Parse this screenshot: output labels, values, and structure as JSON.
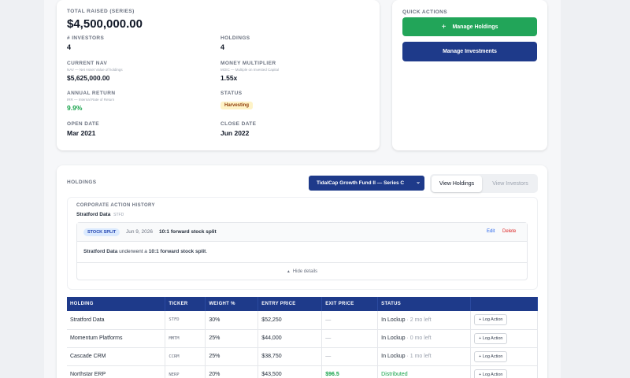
{
  "summary": {
    "total_raised_label": "TOTAL RAISED (SERIES)",
    "total_raised_value": "$4,500,000.00",
    "investors_label": "# INVESTORS",
    "investors_value": "4",
    "holdings_label": "HOLDINGS",
    "holdings_value": "4",
    "nav_label": "CURRENT NAV",
    "nav_sub": "NAV — Net Asset Value of holdings",
    "nav_value": "$5,625,000.00",
    "moic_label": "MONEY MULTIPLIER",
    "moic_sub": "MOIC — Multiple on Invested Capital",
    "moic_value": "1.55x",
    "return_label": "ANNUAL RETURN",
    "return_sub": "IRR — Internal Rate of Return",
    "return_value": "9.9%",
    "status_label": "STATUS",
    "status_value": "Harvesting",
    "open_label": "OPEN DATE",
    "open_value": "Mar 2021",
    "close_label": "CLOSE DATE",
    "close_value": "Jun 2022"
  },
  "quick_actions": {
    "title": "QUICK ACTIONS",
    "manage_holdings": "Manage Holdings",
    "manage_investments": "Manage Investments"
  },
  "holdings_section": {
    "title": "HOLDINGS",
    "fund_select": "TidalCap Growth Fund II — Series C",
    "tab_holdings": "View Holdings",
    "tab_investors": "View Investors"
  },
  "corporate_action": {
    "title": "CORPORATE ACTION HISTORY",
    "company": "Stratford Data",
    "ticker": "STFD",
    "tag": "STOCK SPLIT",
    "date": "Jun 9, 2026",
    "headline": "10:1 forward stock split",
    "edit": "Edit",
    "delete": "Delete",
    "desc_company": "Stratford Data",
    "desc_mid": " underwent a ",
    "desc_bold": "10:1 forward stock split",
    "desc_end": ".",
    "hide_details": "Hide details"
  },
  "table": {
    "headers": [
      "HOLDING",
      "TICKER",
      "WEIGHT %",
      "ENTRY PRICE",
      "EXIT PRICE",
      "STATUS",
      ""
    ],
    "rows": [
      {
        "holding": "Stratford Data",
        "ticker": "STFD",
        "weight": "30%",
        "entry": "$52,250",
        "exit": "—",
        "status": "In Lockup",
        "status_note": "· 2 mo left",
        "action": "+ Log Action"
      },
      {
        "holding": "Momentum Platforms",
        "ticker": "MMTM",
        "weight": "25%",
        "entry": "$44,000",
        "exit": "—",
        "status": "In Lockup",
        "status_note": "· 0 mo left",
        "action": "+ Log Action"
      },
      {
        "holding": "Cascade CRM",
        "ticker": "CCRM",
        "weight": "25%",
        "entry": "$38,750",
        "exit": "—",
        "status": "In Lockup",
        "status_note": "· 1 mo left",
        "action": "+ Log Action"
      },
      {
        "holding": "Northstar ERP",
        "ticker": "NERP",
        "weight": "20%",
        "entry": "$43,500",
        "exit": "$96.5",
        "status": "Distributed",
        "status_note": "",
        "action": "+ Log Action"
      }
    ]
  },
  "colors": {
    "green_button": "#22a559",
    "navy": "#1e3a8a",
    "positive": "#16a34a"
  }
}
